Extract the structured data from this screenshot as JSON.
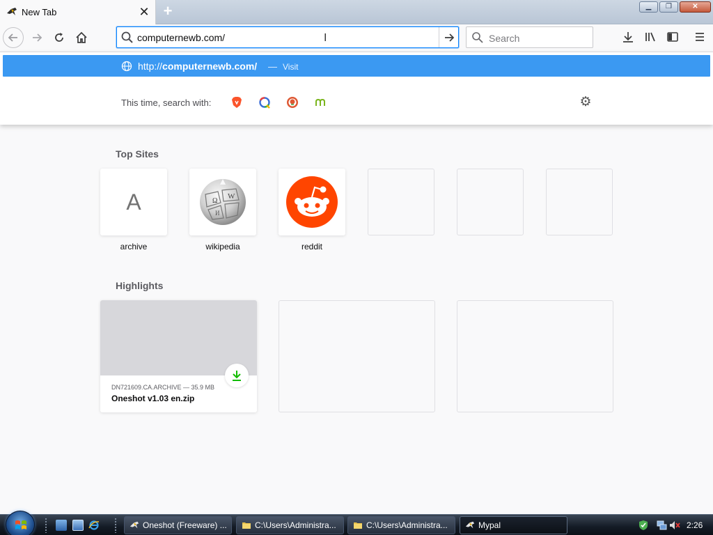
{
  "browser": {
    "tab": {
      "title": "New Tab",
      "close_glyph": "✕",
      "favicon": "mypal-bird-icon"
    },
    "new_tab_glyph": "+",
    "window_controls": {
      "minimize": "▁",
      "maximize": "❐",
      "close": "✕"
    }
  },
  "navbar": {
    "url_value": "computernewb.com/",
    "search_placeholder": "Search"
  },
  "dropdown": {
    "suggestion": {
      "url_prefix": "http://",
      "url_bold": "computernewb.com/",
      "separator": "—",
      "action": "Visit"
    },
    "oneoff_label": "This time, search with:",
    "engines": [
      "brave-icon",
      "qwant-icon",
      "duckduckgo-icon",
      "mojeek-icon"
    ]
  },
  "top_sites": {
    "title": "Top Sites",
    "items": [
      {
        "label": "archive",
        "letter": "A"
      },
      {
        "label": "wikipedia"
      },
      {
        "label": "reddit"
      },
      {
        "label": ""
      },
      {
        "label": ""
      },
      {
        "label": ""
      }
    ]
  },
  "highlights": {
    "title": "Highlights",
    "items": [
      {
        "meta": "DN721609.CA.ARCHIVE — 35.9 MB",
        "title": "Oneshot v1.03 en.zip"
      }
    ]
  },
  "taskbar": {
    "buttons": [
      {
        "label": "Oneshot (Freeware) ..."
      },
      {
        "label": "C:\\Users\\Administra..."
      },
      {
        "label": "C:\\Users\\Administra..."
      },
      {
        "label": "Mypal"
      }
    ],
    "clock": "2:26"
  },
  "colors": {
    "accent": "#0a84ff",
    "suggestion_bg": "#3b99f2",
    "reddit": "#ff4500",
    "download_green": "#12bc00"
  }
}
